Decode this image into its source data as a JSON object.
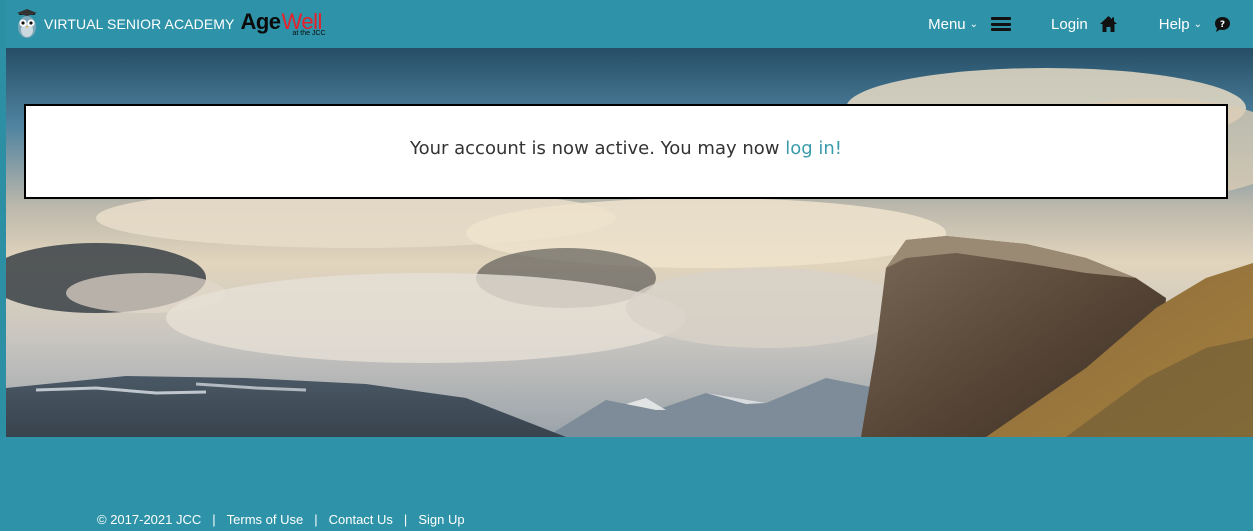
{
  "header": {
    "brand_name": "VIRTUAL SENIOR ACADEMY",
    "logo_age": "Age",
    "logo_well": "Well",
    "logo_sub": "at the JCC",
    "nav": {
      "menu_label": "Menu",
      "login_label": "Login",
      "help_label": "Help"
    },
    "icons": {
      "owl": "owl-logo-icon",
      "menu": "hamburger-icon",
      "login": "home-icon",
      "help": "question-bubble-icon",
      "chevron": "chevron-down-icon"
    }
  },
  "message": {
    "text": "Your account is now active. You may now ",
    "link_text": "log in!"
  },
  "footer": {
    "copyright": "© 2017-2021 JCC",
    "separator": "|",
    "terms": "Terms of Use",
    "contact": "Contact Us",
    "signup": "Sign Up"
  },
  "colors": {
    "brand_teal": "#2e93a8",
    "link": "#3a9cab",
    "logo_red": "#e8202a"
  }
}
